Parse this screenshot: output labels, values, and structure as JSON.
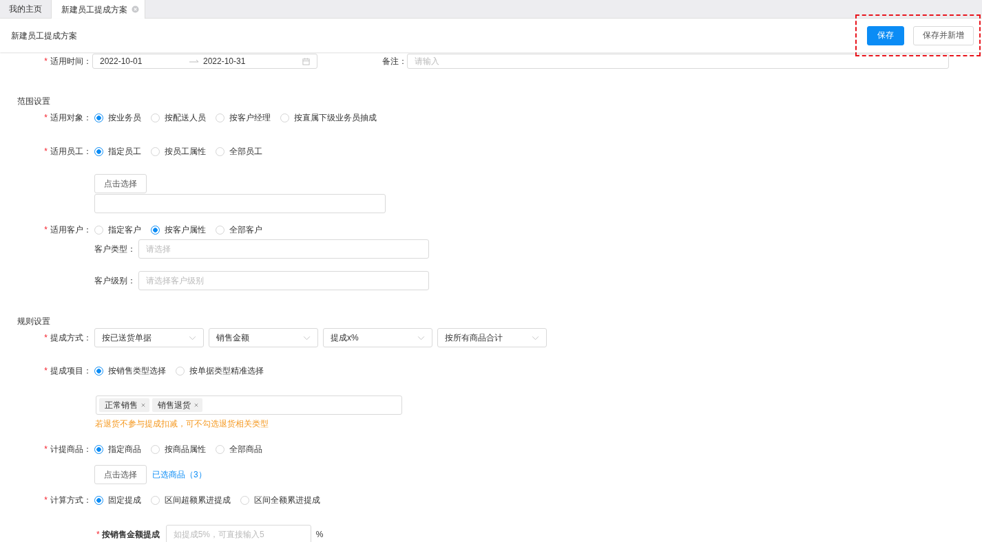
{
  "tabs": [
    {
      "label": "我的主页",
      "selected": false,
      "closable": false
    },
    {
      "label": "新建员工提成方案",
      "selected": true,
      "closable": true
    }
  ],
  "header": {
    "title": "新建员工提成方案",
    "buttons": [
      {
        "label": "保存",
        "kind": "primary"
      },
      {
        "label": "保存并新增",
        "kind": "default"
      }
    ]
  },
  "form": {
    "rows": [
      {
        "kind": "date_range",
        "required_mark": "*",
        "label": "适用时间：",
        "start": "2022-10-01",
        "end": "2022-10-31",
        "remark": {
          "label": "备注：",
          "placeholder": "请输入"
        }
      },
      {
        "kind": "section",
        "label": "范围设置"
      },
      {
        "kind": "radio",
        "required_mark": "*",
        "label": "适用对象：",
        "options": [
          {
            "label": "按业务员",
            "selected": true
          },
          {
            "label": "按配送人员",
            "selected": false
          },
          {
            "label": "按客户经理",
            "selected": false
          },
          {
            "label": "按直属下级业务员抽成",
            "selected": false
          }
        ]
      },
      {
        "kind": "radio",
        "required_mark": "*",
        "label": "适用员工：",
        "options": [
          {
            "label": "指定员工",
            "selected": true
          },
          {
            "label": "按员工属性",
            "selected": false
          },
          {
            "label": "全部员工",
            "selected": false
          }
        ]
      },
      {
        "kind": "button",
        "label": "点击选择"
      },
      {
        "kind": "input"
      },
      {
        "kind": "radio",
        "required_mark": "*",
        "label": "适用客户：",
        "options": [
          {
            "label": "指定客户",
            "selected": false
          },
          {
            "label": "按客户属性",
            "selected": true
          },
          {
            "label": "全部客户",
            "selected": false
          }
        ]
      },
      {
        "kind": "sub_select",
        "label": "客户类型：",
        "placeholder": "请选择"
      },
      {
        "kind": "sub_select",
        "label": "客户级别：",
        "placeholder": "请选择客户级别"
      },
      {
        "kind": "section",
        "label": "规则设置"
      },
      {
        "kind": "selects",
        "required_mark": "*",
        "label": "提成方式：",
        "values": [
          "按已送货单据",
          "销售金额",
          "提成x%",
          "按所有商品合计"
        ]
      },
      {
        "kind": "radio",
        "required_mark": "*",
        "label": "提成项目：",
        "options": [
          {
            "label": "按销售类型选择",
            "selected": true
          },
          {
            "label": "按单据类型精准选择",
            "selected": false
          }
        ]
      },
      {
        "kind": "tags",
        "tags": [
          "正常销售",
          "销售退货"
        ]
      },
      {
        "kind": "hint",
        "text": "若退货不参与提成扣减，可不勾选退货相关类型"
      },
      {
        "kind": "radio",
        "required_mark": "*",
        "label": "计提商品：",
        "options": [
          {
            "label": "指定商品",
            "selected": true
          },
          {
            "label": "按商品属性",
            "selected": false
          },
          {
            "label": "全部商品",
            "selected": false
          }
        ]
      },
      {
        "kind": "button_link",
        "label": "点击选择",
        "link": "已选商品（3）"
      },
      {
        "kind": "radio",
        "required_mark": "*",
        "label": "计算方式：",
        "options": [
          {
            "label": "固定提成",
            "selected": true
          },
          {
            "label": "区间超额累进提成",
            "selected": false
          },
          {
            "label": "区间全额累进提成",
            "selected": false
          }
        ]
      },
      {
        "kind": "percent_input",
        "required_mark": "*",
        "label": "按销售金额提成",
        "placeholder": "如提成5%，可直接输入5",
        "unit": "%"
      }
    ]
  }
}
